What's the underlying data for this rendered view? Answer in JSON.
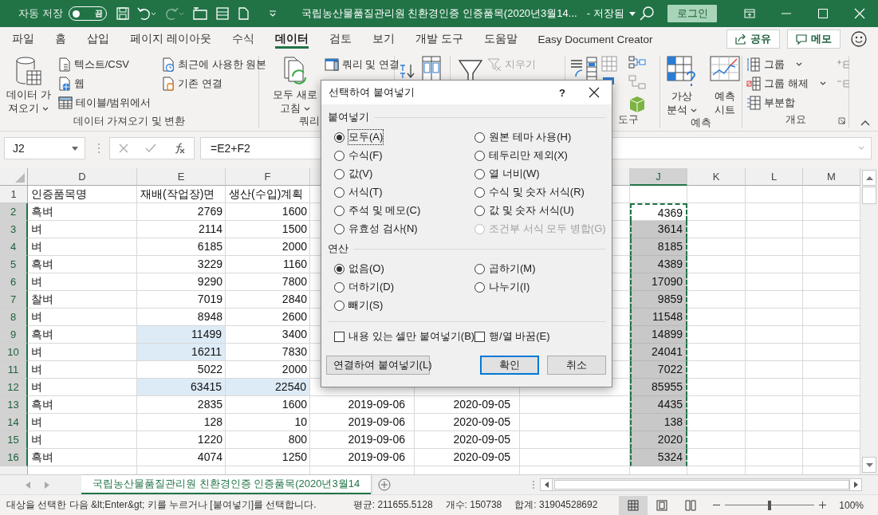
{
  "title_bar": {
    "autosave": {
      "label": "자동 저장",
      "on": false,
      "state_label": "끔"
    },
    "title": "국립농산물품질관리원 친환경인증 인증품목(2020년3월14...",
    "save_status": "- 저장됨",
    "login": "로그인"
  },
  "tabs": [
    {
      "label": "파일",
      "selected": false
    },
    {
      "label": "홈",
      "selected": false
    },
    {
      "label": "삽입",
      "selected": false
    },
    {
      "label": "페이지 레이아웃",
      "selected": false
    },
    {
      "label": "수식",
      "selected": false
    },
    {
      "label": "데이터",
      "selected": true
    },
    {
      "label": "검토",
      "selected": false
    },
    {
      "label": "보기",
      "selected": false
    },
    {
      "label": "개발 도구",
      "selected": false
    },
    {
      "label": "도움말",
      "selected": false
    },
    {
      "label": "Easy Document Creator",
      "selected": false
    }
  ],
  "share_button": "공유",
  "memo_button": "메모",
  "ribbon": {
    "groups": [
      {
        "label": "데이터 가져오기 및 변환",
        "items": [
          {
            "kind": "large",
            "label": "데이터 가\n져오기",
            "dropdown": true,
            "disabled": false
          },
          {
            "kind": "small",
            "label": "텍스트/CSV",
            "dropdown": false,
            "disabled": false
          },
          {
            "kind": "small",
            "label": "웹",
            "dropdown": false,
            "disabled": false
          },
          {
            "kind": "small",
            "label": "테이블/범위에서",
            "dropdown": false,
            "disabled": false
          },
          {
            "kind": "small",
            "label": "최근에 사용한 원본",
            "dropdown": false,
            "disabled": false
          },
          {
            "kind": "small",
            "label": "기존 연결",
            "dropdown": false,
            "disabled": false
          }
        ]
      },
      {
        "label": "쿼리",
        "items": [
          {
            "kind": "large",
            "label": "모두 새로\n고침",
            "dropdown": true,
            "disabled": false
          },
          {
            "kind": "small",
            "label": "쿼리 및 연결",
            "dropdown": false,
            "disabled": false
          }
        ]
      },
      {
        "items": [
          {
            "kind": "small",
            "label": "지우기",
            "dropdown": false,
            "disabled": true
          }
        ]
      },
      {
        "label": "도구"
      },
      {
        "label": "예측",
        "items": [
          {
            "kind": "large",
            "label": "가상\n분석",
            "dropdown": true,
            "disabled": false
          },
          {
            "kind": "large",
            "label": "예측\n시트",
            "dropdown": false,
            "disabled": false
          }
        ]
      },
      {
        "label": "개요",
        "items": [
          {
            "kind": "small",
            "label": "그룹",
            "dropdown": true,
            "disabled": false
          },
          {
            "kind": "small",
            "label": "그룹 해제",
            "dropdown": true,
            "disabled": false
          },
          {
            "kind": "small",
            "label": "부분합",
            "dropdown": false,
            "disabled": false
          }
        ]
      }
    ]
  },
  "name_box": "J2",
  "formula": "=E2+F2",
  "columns": {
    "d": {
      "label": "D",
      "selected": false
    },
    "e": {
      "label": "E",
      "selected": false
    },
    "f": {
      "label": "F",
      "selected": false
    },
    "j": {
      "label": "J",
      "selected": true
    },
    "k": {
      "label": "K",
      "selected": false
    },
    "l": {
      "label": "L",
      "selected": false
    },
    "m": {
      "label": "M",
      "selected": false
    }
  },
  "rows": [
    {
      "header": "1",
      "selected": false,
      "d": "인증품목명",
      "e": "재배(작업장)면",
      "f": "생산(수입)계획"
    },
    {
      "header": "2",
      "selected": true,
      "active": true,
      "d": "흑벼",
      "e": "2769",
      "f": "1600",
      "j": "4369"
    },
    {
      "header": "3",
      "selected": true,
      "active": false,
      "d": "벼",
      "e": "2114",
      "f": "1500",
      "j": "3614"
    },
    {
      "header": "4",
      "selected": true,
      "active": false,
      "d": "벼",
      "e": "6185",
      "f": "2000",
      "j": "8185"
    },
    {
      "header": "5",
      "selected": true,
      "active": false,
      "d": "흑벼",
      "e": "3229",
      "f": "1160",
      "j": "4389"
    },
    {
      "header": "6",
      "selected": true,
      "active": false,
      "d": "벼",
      "e": "9290",
      "f": "7800",
      "j": "17090"
    },
    {
      "header": "7",
      "selected": true,
      "active": false,
      "d": "찰벼",
      "e": "7019",
      "f": "2840",
      "j": "9859"
    },
    {
      "header": "8",
      "selected": true,
      "active": false,
      "d": "벼",
      "e": "8948",
      "f": "2600",
      "j": "11548"
    },
    {
      "header": "9",
      "selected": true,
      "active": false,
      "d": "흑벼",
      "e": "11499",
      "f": "3400",
      "j": "14899",
      "highlighted": {
        "e": true
      }
    },
    {
      "header": "10",
      "selected": true,
      "active": false,
      "d": "벼",
      "e": "16211",
      "f": "7830",
      "j": "24041",
      "highlighted": {
        "e": true
      }
    },
    {
      "header": "11",
      "selected": true,
      "active": false,
      "d": "벼",
      "e": "5022",
      "f": "2000",
      "j": "7022"
    },
    {
      "header": "12",
      "selected": true,
      "active": false,
      "d": "벼",
      "e": "63415",
      "f": "22540",
      "j": "85955",
      "highlighted": {
        "e": true,
        "f": true
      }
    },
    {
      "header": "13",
      "selected": true,
      "active": false,
      "d": "흑벼",
      "e": "2835",
      "f": "1600",
      "g": "2019-09-06",
      "h": "2020-09-05",
      "j": "4435"
    },
    {
      "header": "14",
      "selected": true,
      "active": false,
      "d": "벼",
      "e": "128",
      "f": "10",
      "g": "2019-09-06",
      "h": "2020-09-05",
      "j": "138"
    },
    {
      "header": "15",
      "selected": true,
      "active": false,
      "d": "벼",
      "e": "1220",
      "f": "800",
      "g": "2019-09-06",
      "h": "2020-09-05",
      "j": "2020"
    },
    {
      "header": "16",
      "selected": true,
      "active": false,
      "d": "흑벼",
      "e": "4074",
      "f": "1250",
      "g": "2019-09-06",
      "h": "2020-09-05",
      "j": "5324"
    }
  ],
  "sheet_tabs": [
    {
      "label": "국립농산물품질관리원 친환경인증 인증품목(2020년3월14",
      "selected": true
    }
  ],
  "status_bar": {
    "message": "대상을 선택한 다음 &lt;Enter&gt; 키를 누르거나 [붙여넣기]를 선택합니다.",
    "average": "평균: 211655.5128",
    "count": "개수: 150738",
    "sum": "합계: 31904528692",
    "views": [
      {
        "kind": "normal",
        "selected": true
      },
      {
        "kind": "page_layout",
        "selected": false
      },
      {
        "kind": "page_break",
        "selected": false
      }
    ],
    "zoom": {
      "level": 0.5,
      "label": "100%"
    }
  },
  "dialog": {
    "title": "선택하여 붙여넣기",
    "help": "?",
    "paste": {
      "label": "붙여넣기",
      "options": [
        {
          "label": "모두(A)",
          "selected": true,
          "disabled": false,
          "focused": true
        },
        {
          "label": "원본 테마 사용(H)",
          "selected": false,
          "disabled": false,
          "focused": false
        },
        {
          "label": "수식(F)",
          "selected": false,
          "disabled": false,
          "focused": false
        },
        {
          "label": "테두리만 제외(X)",
          "selected": false,
          "disabled": false,
          "focused": false
        },
        {
          "label": "값(V)",
          "selected": false,
          "disabled": false,
          "focused": false
        },
        {
          "label": "열 너비(W)",
          "selected": false,
          "disabled": false,
          "focused": false
        },
        {
          "label": "서식(T)",
          "selected": false,
          "disabled": false,
          "focused": false
        },
        {
          "label": "수식 및 숫자 서식(R)",
          "selected": false,
          "disabled": false,
          "focused": false
        },
        {
          "label": "주석 및 메모(C)",
          "selected": false,
          "disabled": false,
          "focused": false
        },
        {
          "label": "값 및 숫자 서식(U)",
          "selected": false,
          "disabled": false,
          "focused": false
        },
        {
          "label": "유효성 검사(N)",
          "selected": false,
          "disabled": false,
          "focused": false
        },
        {
          "label": "조건부 서식 모두 병합(G)",
          "selected": false,
          "disabled": true,
          "focused": false
        }
      ]
    },
    "operation": {
      "label": "연산",
      "options": [
        {
          "label": "없음(O)",
          "selected": true,
          "disabled": false,
          "focused": false
        },
        {
          "label": "곱하기(M)",
          "selected": false,
          "disabled": false,
          "focused": false
        },
        {
          "label": "더하기(D)",
          "selected": false,
          "disabled": false,
          "focused": false
        },
        {
          "label": "나누기(I)",
          "selected": false,
          "disabled": false,
          "focused": false
        },
        {
          "label": "빼기(S)",
          "selected": false,
          "disabled": false,
          "focused": false
        }
      ]
    },
    "checkboxes": [
      {
        "label": "내용 있는 셀만 붙여넣기(B)",
        "checked": false
      },
      {
        "label": "행/열 바꿈(E)",
        "checked": false
      }
    ],
    "buttons": [
      {
        "label": "연결하여 붙여넣기(L)",
        "kind": "normal"
      },
      {
        "label": "확인",
        "kind": "default"
      },
      {
        "label": "취소",
        "kind": "normal"
      }
    ]
  }
}
